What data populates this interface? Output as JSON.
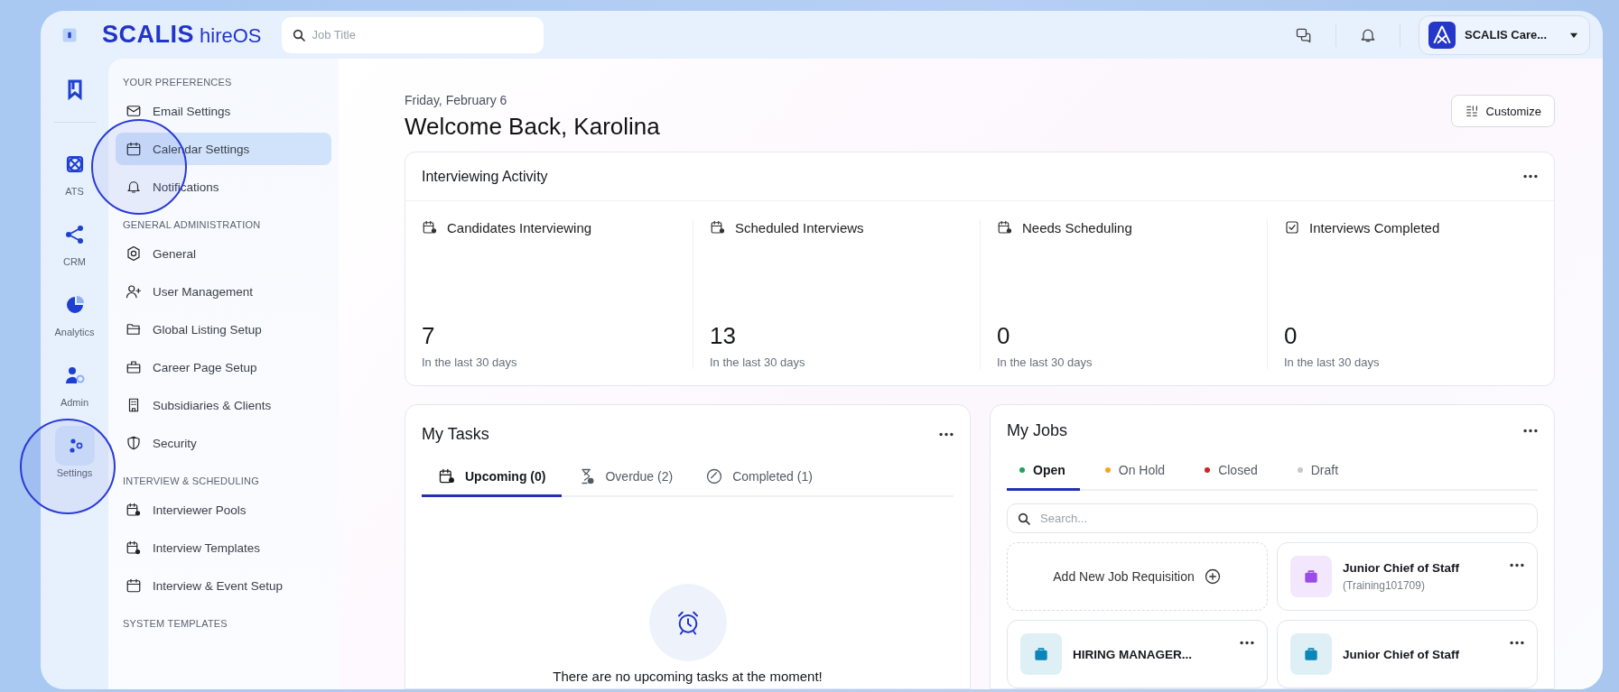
{
  "topbar": {
    "logo": "SCALIS",
    "logo_suffix": "hireOS",
    "search": {
      "placeholder": "Job Title"
    },
    "account": {
      "name": "SCALIS Care..."
    }
  },
  "rail": [
    {
      "kind": "bookmark",
      "selected": false
    },
    {
      "kind": "ats",
      "label": "ATS",
      "selected": false
    },
    {
      "kind": "crm",
      "label": "CRM",
      "selected": false
    },
    {
      "kind": "analytics",
      "label": "Analytics",
      "selected": false
    },
    {
      "kind": "admin",
      "label": "Admin",
      "selected": false
    },
    {
      "kind": "settings",
      "label": "Settings",
      "selected": true
    }
  ],
  "settings_menu": [
    {
      "heading": "YOUR PREFERENCES",
      "items": [
        {
          "kind": "mail",
          "label": "Email Settings",
          "selected": false
        },
        {
          "kind": "calendar",
          "label": "Calendar Settings",
          "selected": true
        },
        {
          "kind": "bell",
          "label": "Notifications",
          "selected": false
        }
      ]
    },
    {
      "heading": "GENERAL ADMINISTRATION",
      "items": [
        {
          "kind": "gear",
          "label": "General",
          "selected": false
        },
        {
          "kind": "user-plus",
          "label": "User Management",
          "selected": false
        },
        {
          "kind": "folder",
          "label": "Global Listing Setup",
          "selected": false
        },
        {
          "kind": "briefcase",
          "label": "Career Page Setup",
          "selected": false
        },
        {
          "kind": "building",
          "label": "Subsidiaries & Clients",
          "selected": false
        },
        {
          "kind": "shield",
          "label": "Security",
          "selected": false
        }
      ]
    },
    {
      "heading": "INTERVIEW & SCHEDULING",
      "items": [
        {
          "kind": "calendar-user",
          "label": "Interviewer Pools",
          "selected": false
        },
        {
          "kind": "calendar-gear",
          "label": "Interview Templates",
          "selected": false
        },
        {
          "kind": "calendar",
          "label": "Interview & Event Setup",
          "selected": false
        }
      ]
    },
    {
      "heading": "SYSTEM TEMPLATES"
    }
  ],
  "main": {
    "date": "Friday, February 6",
    "greeting": "Welcome Back, Karolina",
    "customize": "Customize"
  },
  "activity": {
    "title": "Interviewing Activity",
    "stats": [
      {
        "kind": "calendar-user",
        "label": "Candidates Interviewing",
        "value": "7",
        "caption": "In the last 30 days"
      },
      {
        "kind": "calendar-user",
        "label": "Scheduled Interviews",
        "value": "13",
        "caption": "In the last 30 days"
      },
      {
        "kind": "calendar-user",
        "label": "Needs Scheduling",
        "value": "0",
        "caption": "In the last 30 days"
      },
      {
        "kind": "check",
        "label": "Interviews Completed",
        "value": "0",
        "caption": "In the last 30 days"
      }
    ]
  },
  "tasks": {
    "title": "My Tasks",
    "tabs": [
      {
        "kind": "calendar-user",
        "label": "Upcoming (0)",
        "selected": true
      },
      {
        "kind": "hourglass",
        "label": "Overdue (2)",
        "selected": false
      },
      {
        "kind": "check-circle",
        "label": "Completed (1)",
        "selected": false
      }
    ],
    "empty": "There are no upcoming tasks at the moment!"
  },
  "jobs": {
    "title": "My Jobs",
    "tabs": [
      {
        "label": "Open",
        "color": "#1fa35b",
        "selected": true
      },
      {
        "label": "On Hold",
        "color": "#f5a524",
        "selected": false
      },
      {
        "label": "Closed",
        "color": "#d61f1f",
        "selected": false
      },
      {
        "label": "Draft",
        "color": "#c4c8d0",
        "selected": false
      }
    ],
    "search": {
      "placeholder": "Search..."
    },
    "add": "Add New Job Requisition",
    "cards": [
      {
        "title": "Junior Chief of Staff",
        "subtitle": "(Training101709)",
        "color": "#9b4be8"
      },
      {
        "title": "HIRING MANAGER...",
        "color": "#0a86b8"
      },
      {
        "title": "Junior Chief of Staff",
        "color": "#0a86b8"
      }
    ]
  }
}
